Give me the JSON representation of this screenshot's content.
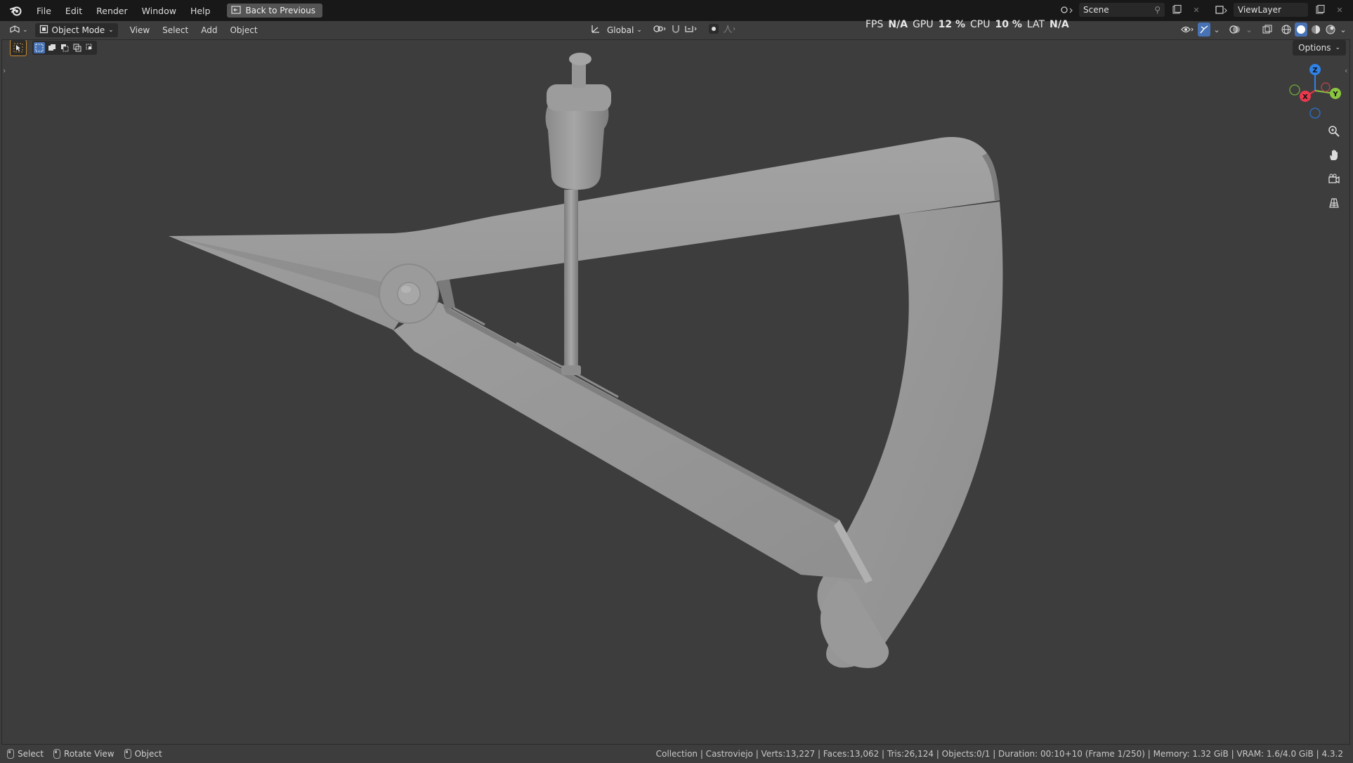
{
  "menu": {
    "items": [
      "File",
      "Edit",
      "Render",
      "Window",
      "Help"
    ],
    "back_button": "Back to Previous"
  },
  "top_right": {
    "scene_name": "Scene",
    "view_layer": "ViewLayer"
  },
  "header": {
    "mode": "Object Mode",
    "menus": [
      "View",
      "Select",
      "Add",
      "Object"
    ],
    "transform_orientation": "Global"
  },
  "stats": {
    "fps_label": "FPS",
    "fps_value": "N/A",
    "gpu_label": "GPU",
    "gpu_value": "12 %",
    "cpu_label": "CPU",
    "cpu_value": "10 %",
    "lat_label": "LAT",
    "lat_value": "N/A"
  },
  "viewport": {
    "options_label": "Options",
    "gizmo_axes": {
      "z": "Z",
      "y": "Y",
      "x": "X"
    }
  },
  "statusbar": {
    "hints": [
      "Select",
      "Rotate View",
      "Object"
    ],
    "info": "Collection | Castroviejo | Verts:13,227 | Faces:13,062 | Tris:26,124 | Objects:0/1 | Duration: 00:10+10 (Frame 1/250) | Memory: 1.32 GiB | VRAM: 1.6/4.0 GiB | 4.3.2"
  },
  "colors": {
    "topbar": "#181818",
    "viewport_bg": "#3d3d3d",
    "model": "#9a9a9a",
    "accent_blue": "#4772b3",
    "axis_x": "#e8394d",
    "axis_y": "#8bc540",
    "axis_z": "#2f83e8"
  }
}
